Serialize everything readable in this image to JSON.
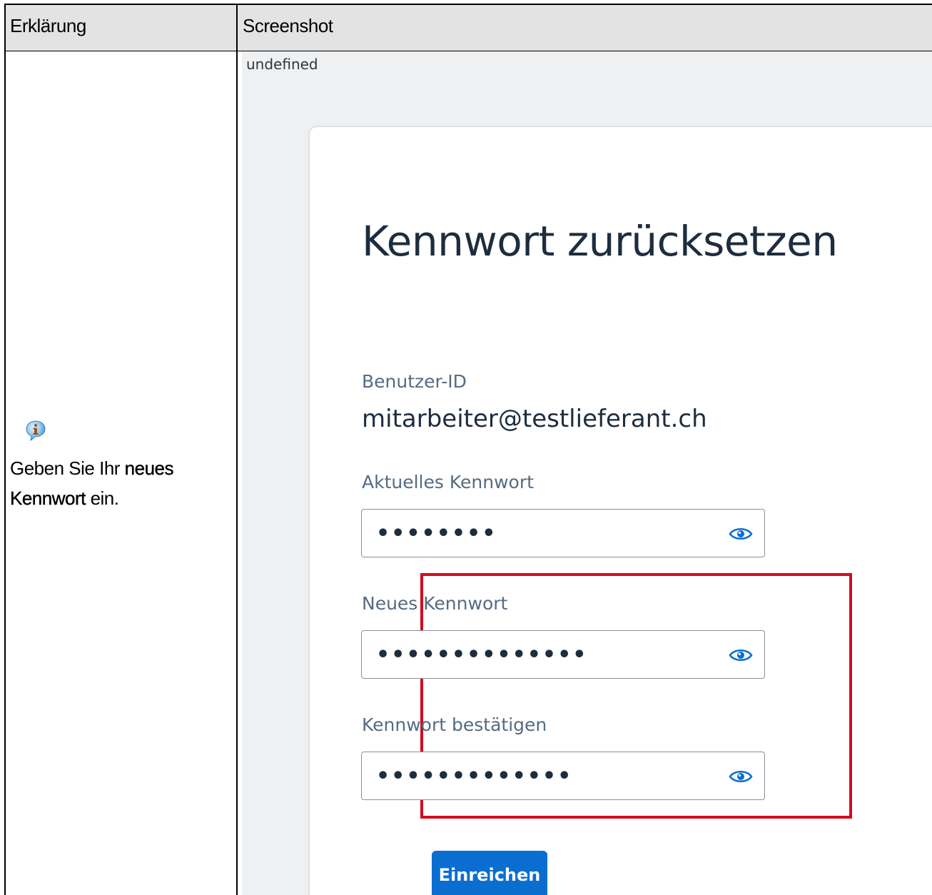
{
  "table": {
    "header_explanation": "Erklärung",
    "header_screenshot": "Screenshot"
  },
  "explanation": {
    "icon": "info-icon",
    "text_before": "Geben Sie Ihr ",
    "text_bold": "neues Kennwort",
    "text_after": " ein."
  },
  "screenshot": {
    "label": "undefined",
    "title": "Kennwort zurücksetzen",
    "user_id_label": "Benutzer-ID",
    "user_id_value": "mitarbeiter@testlieferant.ch",
    "current_password_label": "Aktuelles Kennwort",
    "current_password_value": "••••••••",
    "new_password_label": "Neues Kennwort",
    "new_password_value": "••••••••••••••",
    "confirm_password_label": "Kennwort bestätigen",
    "confirm_password_value": "•••••••••••••",
    "submit_label": "Einreichen",
    "eye_icon": "eye-icon",
    "colors": {
      "accent": "#0a6ed1",
      "highlight": "#d40b1f",
      "background": "#eff0f1"
    }
  }
}
